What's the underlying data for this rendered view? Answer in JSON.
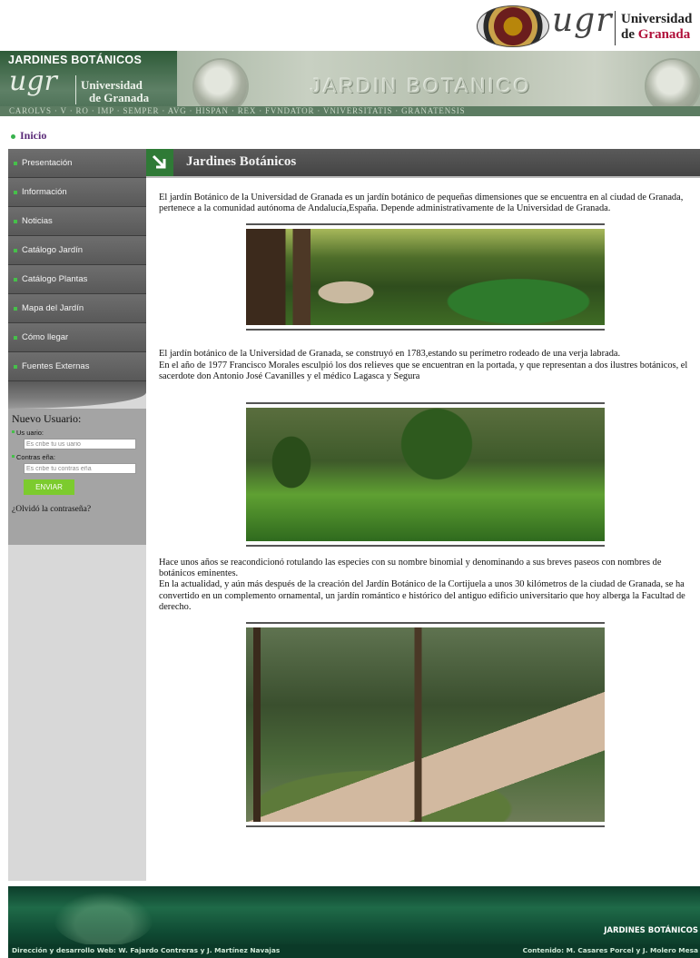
{
  "header": {
    "logo_text": "ugr",
    "university_line1": "Universidad",
    "university_line2_de": "de",
    "university_line2_city": "Granada"
  },
  "banner": {
    "site_title": "JARDINES BOTÁNICOS",
    "logo_text": "ugr",
    "university_line1": "Universidad",
    "university_line2": "de Granada",
    "stone_text": "JARDIN BOTANICO",
    "inscription": "CAROLVS · V · RO · IMP · SEMPER · AVG · HISPAN · REX · FVNDATOR · VNIVERSITATIS · GRANATENSIS"
  },
  "breadcrumb": {
    "home_label": "Inicio"
  },
  "sidebar": {
    "menu": [
      {
        "label": "Presentación"
      },
      {
        "label": "Información"
      },
      {
        "label": "Noticias"
      },
      {
        "label": "Catálogo Jardín"
      },
      {
        "label": "Catálogo Plantas"
      },
      {
        "label": "Mapa del Jardín"
      },
      {
        "label": "Cómo llegar"
      },
      {
        "label": "Fuentes Externas"
      }
    ],
    "login": {
      "title": "Nuevo Usuario:",
      "user_label": "Us uario:",
      "user_placeholder": "Es cribe tu us uario",
      "password_label": "Contras eña:",
      "password_placeholder": "Es cribe tu contras eña",
      "submit_label": "ENVIAR",
      "forgot_label": "¿Olvidó la contraseña?"
    }
  },
  "content": {
    "title": "Jardines Botánicos",
    "paragraph1": "El jardín Botánico de la Universidad de Granada es un jardín botánico de pequeñas dimensiones que se encuentra en al ciudad de Granada, pertenece a la comunidad autónoma de Andalucía,España. Depende administrativamente de la Universidad de Granada.",
    "paragraph2a": "El jardín botánico de la Universidad de Granada, se construyó en 1783,estando su perímetro rodeado de una verja labrada.",
    "paragraph2b": "En el año de 1977 Francisco Morales esculpió los dos relieves que se encuentran en la portada, y que representan a dos ilustres botánicos, el sacerdote don Antonio José Cavanilles y el médico Lagasca y Segura",
    "paragraph3a": "Hace unos años se reacondicionó rotulando las especies con su nombre binomial y denominando a sus breves paseos con nombres de botánicos eminentes.",
    "paragraph3b": "En la actualidad, y aún más después de la creación del Jardín Botánico de la Cortijuela a unos 30 kilómetros de la ciudad de Granada, se ha convertido en un complemento ornamental, un jardín romántico e histórico del antiguo edificio universitario que hoy alberga la Facultad de derecho."
  },
  "footer": {
    "site_title": "JARDINES BOTÁNICOS",
    "credit_web": "Dirección y desarrollo Web: W. Fajardo Contreras y J. Martínez Navajas",
    "credit_content": "Contenido: M. Casares Porcel y J. Molero Mesa"
  },
  "colors": {
    "accent_green": "#37b24d",
    "button_green": "#7ccb2e",
    "brand_red": "#b0103a",
    "footer_green": "#1f6a48"
  }
}
